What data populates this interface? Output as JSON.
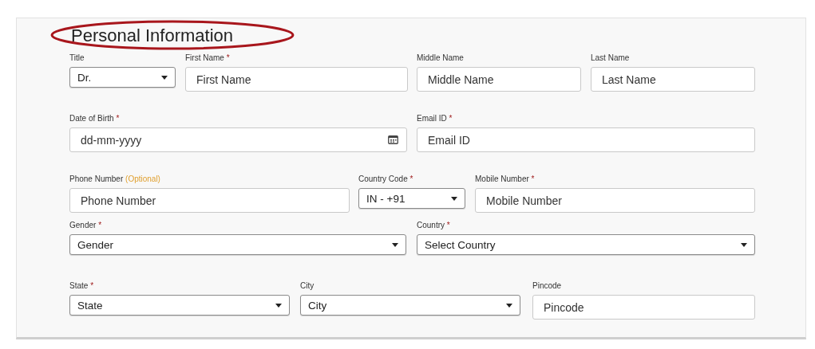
{
  "section": {
    "title": "Personal Information"
  },
  "rows": [
    {
      "fields": [
        {
          "kind": "select",
          "label": "Title",
          "value": "Dr."
        },
        {
          "kind": "input",
          "label": "First Name",
          "mark": "*",
          "placeholder": "First Name"
        },
        {
          "kind": "input",
          "label": "Middle Name",
          "placeholder": "Middle Name"
        },
        {
          "kind": "input",
          "label": "Last Name",
          "placeholder": "Last Name"
        }
      ]
    },
    {
      "fields": [
        {
          "kind": "date",
          "label": "Date of Birth",
          "mark": "*",
          "placeholder": "dd-mm-yyyy"
        },
        {
          "kind": "input",
          "label": "Email ID",
          "mark": "*",
          "placeholder": "Email ID"
        }
      ]
    },
    {
      "fields": [
        {
          "kind": "input",
          "label": "Phone Number",
          "note": "(Optional)",
          "placeholder": "Phone Number"
        },
        {
          "kind": "select",
          "label": "Country Code",
          "mark": "*",
          "value": "IN - +91"
        },
        {
          "kind": "input",
          "label": "Mobile Number",
          "mark": "*",
          "placeholder": "Mobile Number"
        }
      ]
    },
    {
      "fields": [
        {
          "kind": "select",
          "label": "Gender",
          "mark": "*",
          "value": "Gender"
        },
        {
          "kind": "select",
          "label": "Country",
          "mark": "*",
          "value": "Select Country"
        }
      ]
    },
    {
      "fields": [
        {
          "kind": "select",
          "label": "State",
          "mark": "*",
          "value": "State"
        },
        {
          "kind": "select",
          "label": "City",
          "value": "City"
        },
        {
          "kind": "input",
          "label": "Pincode",
          "placeholder": "Pincode"
        }
      ]
    }
  ]
}
